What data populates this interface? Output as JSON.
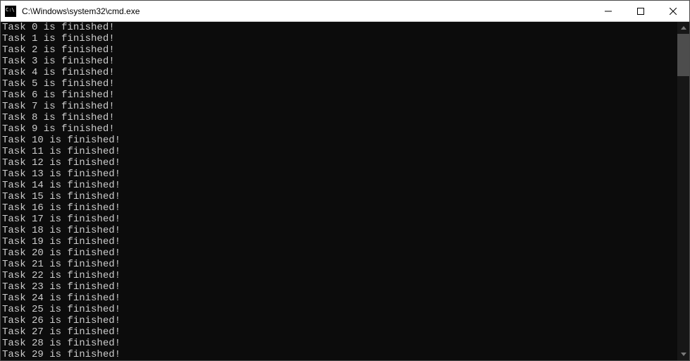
{
  "window": {
    "title": "C:\\Windows\\system32\\cmd.exe",
    "icon_name": "cmd-icon"
  },
  "controls": {
    "minimize": "Minimize",
    "maximize": "Maximize",
    "close": "Close"
  },
  "terminal": {
    "lines": [
      "Task 0 is finished!",
      "Task 1 is finished!",
      "Task 2 is finished!",
      "Task 3 is finished!",
      "Task 4 is finished!",
      "Task 5 is finished!",
      "Task 6 is finished!",
      "Task 7 is finished!",
      "Task 8 is finished!",
      "Task 9 is finished!",
      "Task 10 is finished!",
      "Task 11 is finished!",
      "Task 12 is finished!",
      "Task 13 is finished!",
      "Task 14 is finished!",
      "Task 15 is finished!",
      "Task 16 is finished!",
      "Task 17 is finished!",
      "Task 18 is finished!",
      "Task 19 is finished!",
      "Task 20 is finished!",
      "Task 21 is finished!",
      "Task 22 is finished!",
      "Task 23 is finished!",
      "Task 24 is finished!",
      "Task 25 is finished!",
      "Task 26 is finished!",
      "Task 27 is finished!",
      "Task 28 is finished!",
      "Task 29 is finished!"
    ]
  },
  "colors": {
    "terminal_bg": "#0c0c0c",
    "terminal_fg": "#cccccc",
    "window_bg": "#ffffff"
  }
}
